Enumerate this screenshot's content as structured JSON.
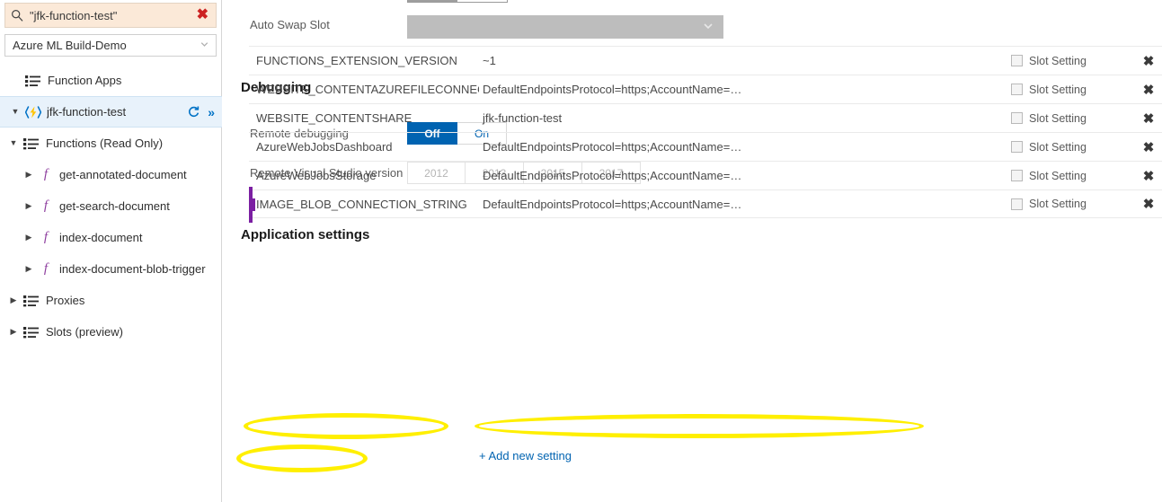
{
  "sidebar": {
    "search": {
      "value": "\"jfk-function-test\"",
      "icon": "search-icon",
      "clear_glyph": "✖"
    },
    "subscription": {
      "value": "Azure ML Build-Demo"
    },
    "root_item": {
      "label": "Function Apps"
    },
    "app": {
      "label": "jfk-function-test",
      "refresh_title": "Refresh",
      "more_glyph": "»"
    },
    "tree": [
      {
        "label": "Functions (Read Only)",
        "level": 1,
        "icon": "list-icon",
        "expanded": true
      },
      {
        "label": "get-annotated-document",
        "level": 2,
        "icon": "function-icon",
        "expanded": false
      },
      {
        "label": "get-search-document",
        "level": 2,
        "icon": "function-icon",
        "expanded": false
      },
      {
        "label": "index-document",
        "level": 2,
        "icon": "function-icon",
        "expanded": false
      },
      {
        "label": "index-document-blob-trigger",
        "level": 2,
        "icon": "function-icon",
        "expanded": false
      },
      {
        "label": "Proxies",
        "level": 1,
        "icon": "list-icon",
        "expanded": false
      },
      {
        "label": "Slots (preview)",
        "level": 1,
        "icon": "list-icon",
        "expanded": false
      }
    ]
  },
  "main": {
    "auto_swap": {
      "label": "Auto Swap Slot",
      "value": ""
    },
    "debugging": {
      "title": "Debugging",
      "remote_debugging": {
        "label": "Remote debugging",
        "options": [
          "Off",
          "On"
        ],
        "selected": "Off"
      },
      "vs_version": {
        "label": "Remote Visual Studio version",
        "options": [
          "2012",
          "2013",
          "2015",
          "2017"
        ],
        "selected": ""
      }
    },
    "app_settings": {
      "title": "Application settings",
      "slot_setting_label": "Slot Setting",
      "delete_glyph": "✖",
      "add_new_label": "+ Add new setting",
      "rows": [
        {
          "name": "FUNCTIONS_EXTENSION_VERSION",
          "value": "~1",
          "slot_setting": false
        },
        {
          "name": "WEBSITE_CONTENTAZUREFILECONNECTIO...",
          "value": "DefaultEndpointsProtocol=https;AccountName=…",
          "slot_setting": false
        },
        {
          "name": "WEBSITE_CONTENTSHARE",
          "value": "jfk-function-test",
          "slot_setting": false
        },
        {
          "name": "AzureWebJobsDashboard",
          "value": "DefaultEndpointsProtocol=https;AccountName=…",
          "slot_setting": false
        },
        {
          "name": "AzureWebJobsStorage",
          "value": "DefaultEndpointsProtocol=https;AccountName=…",
          "slot_setting": false
        },
        {
          "name": "IMAGE_BLOB_CONNECTION_STRING",
          "value": "DefaultEndpointsProtocol=https;AccountName=…",
          "slot_setting": false,
          "highlighted": true,
          "editing": true
        }
      ]
    }
  },
  "colors": {
    "accent_blue": "#0063b1",
    "link_blue": "#0063b1",
    "highlight_yellow": "#ffef00",
    "search_bg": "#fbe9d8",
    "selected_row_bg": "#e8f2fb",
    "caret_purple": "#7b1fa2",
    "clear_red": "#cc2222"
  }
}
